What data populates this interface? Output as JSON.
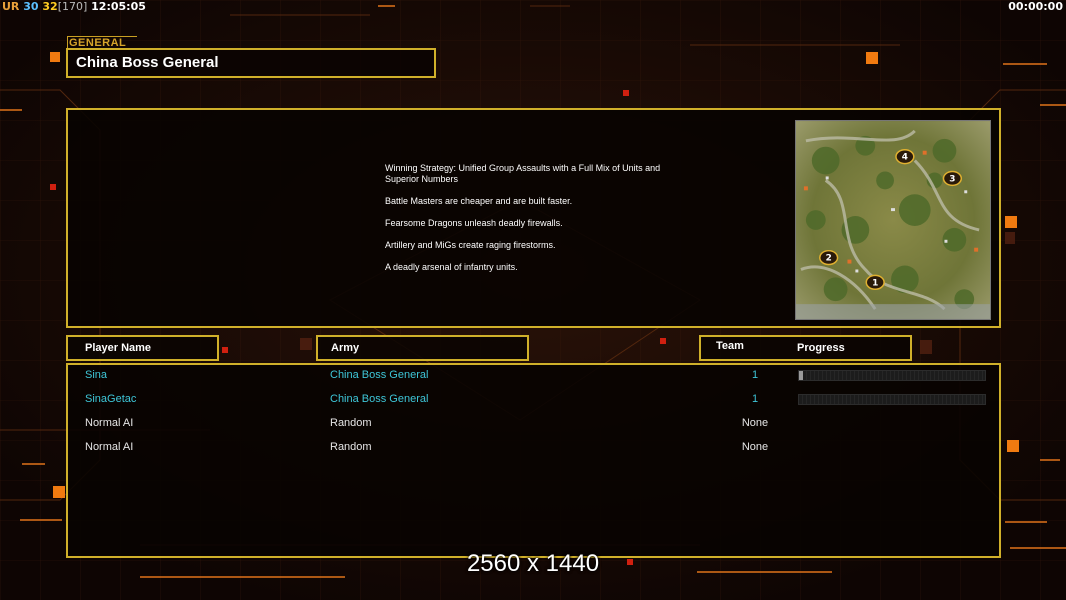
{
  "hud": {
    "ur_label": "UR",
    "value_a": "30",
    "value_b": "32",
    "value_c": "[170]",
    "clock": "12:05:05",
    "game_timer": "00:00:00"
  },
  "general": {
    "section_label": "GENERAL",
    "name": "China Boss General"
  },
  "description": {
    "lines": [
      "Winning Strategy: Unified Group Assaults with a Full Mix of Units and\n Superior Numbers",
      "Battle Masters are cheaper and are built faster.",
      "Fearsome Dragons unleash deadly firewalls.",
      "Artillery and MiGs create raging firestorms.",
      "A deadly arsenal of infantry units."
    ]
  },
  "minimap": {
    "start_positions": [
      "1",
      "2",
      "3",
      "4"
    ]
  },
  "table": {
    "headers": {
      "player_name": "Player Name",
      "army": "Army",
      "team": "Team",
      "progress": "Progress"
    },
    "rows": [
      {
        "name": "Sina",
        "army": "China Boss General",
        "team": "1",
        "kind": "human",
        "progress": 0.02
      },
      {
        "name": "SinaGetac",
        "army": "China Boss General",
        "team": "1",
        "kind": "human",
        "progress": 0.0
      },
      {
        "name": "Normal AI",
        "army": "Random",
        "team": "None",
        "kind": "ai"
      },
      {
        "name": "Normal AI",
        "army": "Random",
        "team": "None",
        "kind": "ai"
      }
    ]
  },
  "resolution_label": "2560 x 1440",
  "colors": {
    "frame": "#d0b02a",
    "human_text": "#3ec6d8",
    "accent_orange": "#f07a10"
  }
}
